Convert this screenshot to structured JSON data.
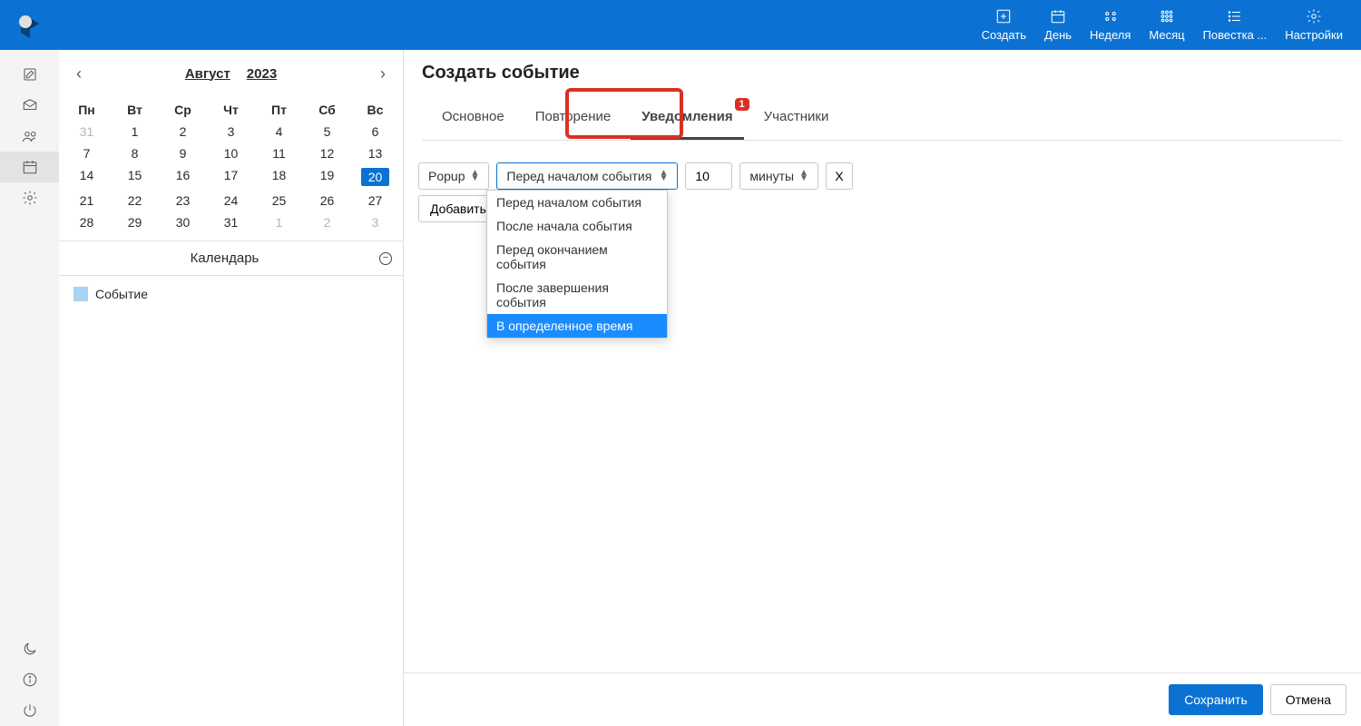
{
  "topbar": {
    "actions": [
      {
        "label": "Создать"
      },
      {
        "label": "День"
      },
      {
        "label": "Неделя"
      },
      {
        "label": "Месяц"
      },
      {
        "label": "Повестка ..."
      },
      {
        "label": "Настройки"
      }
    ]
  },
  "calendar": {
    "month": "Август",
    "year": "2023",
    "dow": [
      "Пн",
      "Вт",
      "Ср",
      "Чт",
      "Пт",
      "Сб",
      "Вс"
    ],
    "weeks": [
      [
        {
          "d": "31",
          "m": true
        },
        {
          "d": "1"
        },
        {
          "d": "2"
        },
        {
          "d": "3"
        },
        {
          "d": "4"
        },
        {
          "d": "5"
        },
        {
          "d": "6"
        }
      ],
      [
        {
          "d": "7"
        },
        {
          "d": "8"
        },
        {
          "d": "9"
        },
        {
          "d": "10"
        },
        {
          "d": "11"
        },
        {
          "d": "12"
        },
        {
          "d": "13"
        }
      ],
      [
        {
          "d": "14"
        },
        {
          "d": "15"
        },
        {
          "d": "16"
        },
        {
          "d": "17"
        },
        {
          "d": "18"
        },
        {
          "d": "19"
        },
        {
          "d": "20",
          "sel": true
        }
      ],
      [
        {
          "d": "21"
        },
        {
          "d": "22"
        },
        {
          "d": "23"
        },
        {
          "d": "24"
        },
        {
          "d": "25"
        },
        {
          "d": "26"
        },
        {
          "d": "27"
        }
      ],
      [
        {
          "d": "28"
        },
        {
          "d": "29"
        },
        {
          "d": "30"
        },
        {
          "d": "31"
        },
        {
          "d": "1",
          "m": true
        },
        {
          "d": "2",
          "m": true
        },
        {
          "d": "3",
          "m": true
        }
      ]
    ],
    "section_title": "Календарь",
    "list": [
      {
        "label": "Событие"
      }
    ]
  },
  "main": {
    "title": "Создать событие",
    "tabs": [
      {
        "label": "Основное"
      },
      {
        "label": "Повторение"
      },
      {
        "label": "Уведомления",
        "active": true,
        "badge": "1"
      },
      {
        "label": "Участники"
      }
    ],
    "row": {
      "type": "Popup",
      "when": "Перед началом события",
      "value": "10",
      "unit": "минуты",
      "remove": "X"
    },
    "dropdown": [
      "Перед началом события",
      "После начала события",
      "Перед окончанием события",
      "После завершения события",
      "В определенное время"
    ],
    "dropdown_highlight_index": 4,
    "add_btn": "Добавить уведомление"
  },
  "footer": {
    "save": "Сохранить",
    "cancel": "Отмена"
  }
}
